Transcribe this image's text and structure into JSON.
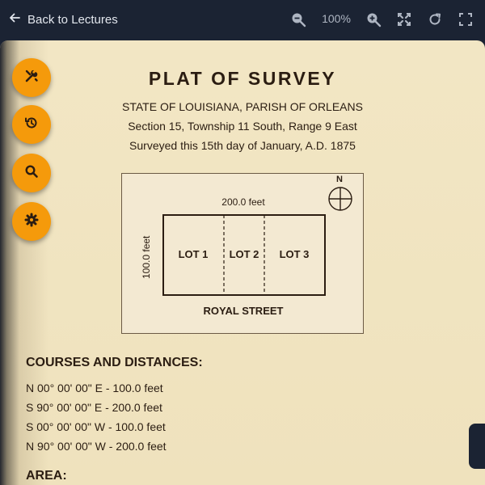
{
  "toolbar": {
    "back_label": "Back to Lectures",
    "zoom_level": "100%",
    "icons": [
      "zoom-out-icon",
      "zoom-in-icon",
      "fit-icon",
      "rotate-icon",
      "fullscreen-icon"
    ]
  },
  "side_tools": [
    "tools-icon",
    "history-icon",
    "search-icon",
    "settings-icon"
  ],
  "document": {
    "title": "PLAT OF SURVEY",
    "header_lines": [
      "STATE OF LOUISIANA, PARISH OF ORLEANS",
      "Section 15, Township 11 South, Range 9 East",
      "Surveyed this 15th day of January, A.D. 1875"
    ],
    "plat": {
      "north": "N",
      "width_label": "200.0 feet",
      "depth_label": "100.0 feet",
      "lots": [
        "LOT 1",
        "LOT 2",
        "LOT 3"
      ],
      "street": "ROYAL STREET"
    },
    "courses_heading": "COURSES AND DISTANCES:",
    "courses": [
      "N 00° 00' 00\" E - 100.0 feet",
      "S 90° 00' 00\" E - 200.0 feet",
      "S 00° 00' 00\" W - 100.0 feet",
      "N 90° 00' 00\" W - 200.0 feet"
    ],
    "area_heading": "AREA:"
  },
  "colors": {
    "toolbar_bg": "#1b2333",
    "accent": "#f59a0b",
    "paper": "#f2e6c4",
    "ink": "#2b1d12"
  }
}
